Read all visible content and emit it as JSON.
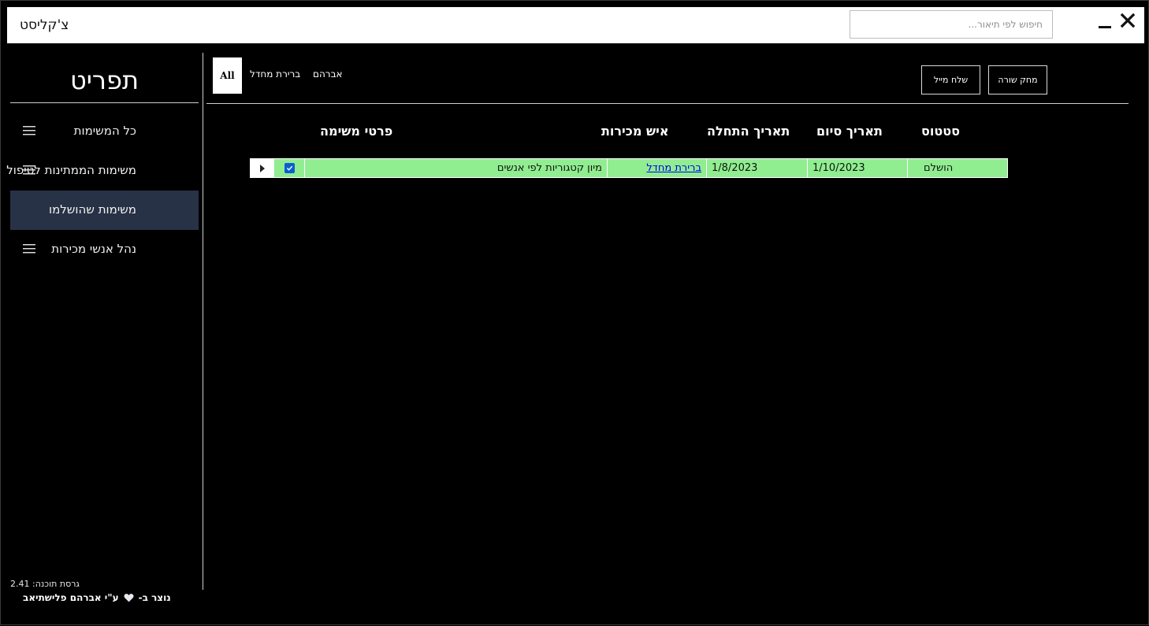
{
  "window": {
    "title": "צ'קליסט",
    "search_placeholder": "חיפוש לפי תיאור..."
  },
  "sidebar": {
    "title": "תפריט",
    "items": [
      {
        "label": "כל המשימות",
        "active": false
      },
      {
        "label": "משימות הממתינות לטיפול",
        "active": false
      },
      {
        "label": "משימות שהושלמו",
        "active": true
      },
      {
        "label": "נהל אנשי מכירות",
        "active": false
      }
    ],
    "version_label": "גרסת תוכנה:",
    "version_number": "2.41",
    "credit_prefix": "נוצר ב-",
    "credit_suffix": "ע\"י אברהם פלישתיאב"
  },
  "filters": {
    "all_label": "All",
    "tabs": [
      "ברירת מחדל",
      "אברהם"
    ]
  },
  "toolbar": {
    "send_mail": "שלח מייל",
    "delete_row": "מחק שורה"
  },
  "table": {
    "columns": {
      "status": "סטטוס",
      "end_date": "תאריך סיום",
      "start_date": "תאריך התחלה",
      "salesperson": "איש מכירות",
      "details": "פרטי משימה"
    },
    "rows": [
      {
        "checked": true,
        "details": "מיון קטגוריות לפי אנשים",
        "salesperson": "ברירת מחדל",
        "start_date": "1/8/2023",
        "end_date": "1/10/2023",
        "status": "הושלם"
      }
    ]
  },
  "colors": {
    "row_completed": "#90ee90",
    "active_nav": "#283246",
    "checkbox": "#0a5fd0"
  }
}
